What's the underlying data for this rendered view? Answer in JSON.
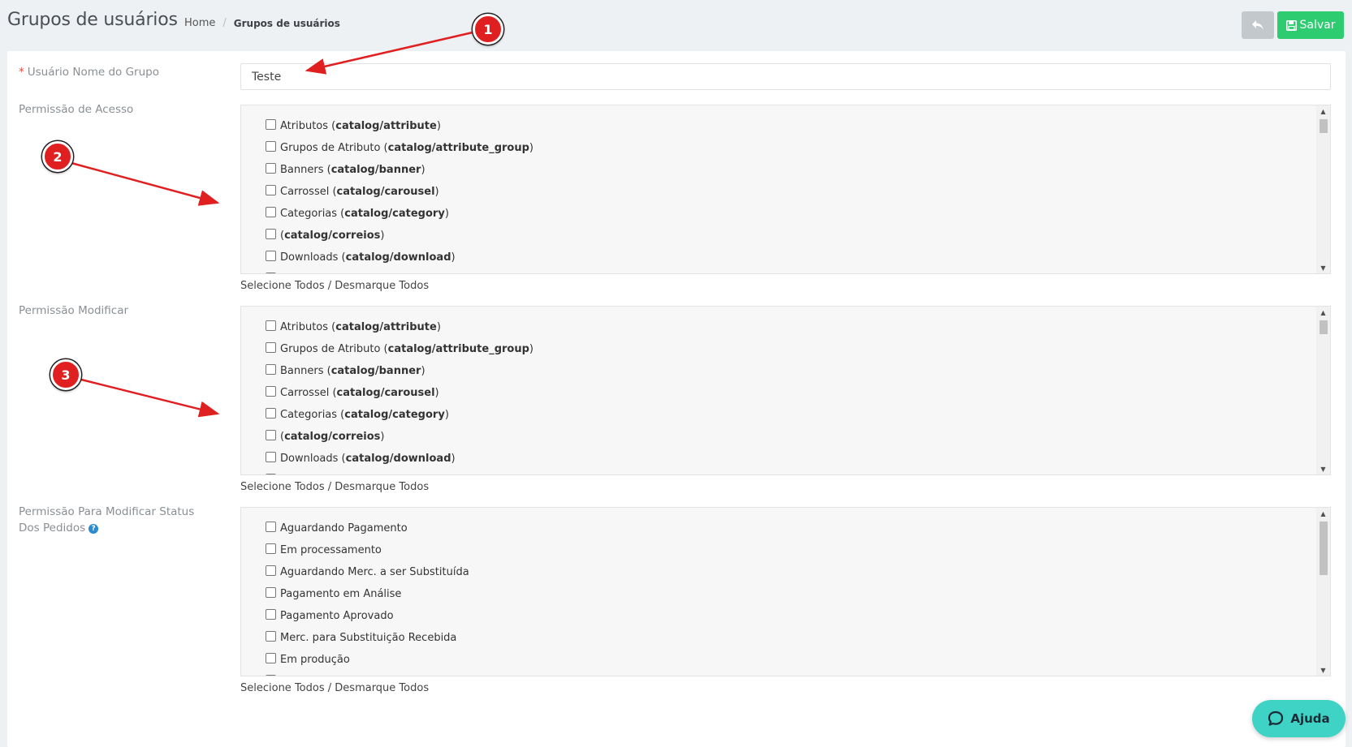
{
  "header": {
    "title": "Grupos de usuários",
    "breadcrumb": [
      {
        "label": "Home"
      },
      {
        "label": "Grupos de usuários"
      }
    ],
    "breadcrumb_separator": "/",
    "save_label": "Salvar",
    "back_icon": "reply-icon",
    "save_icon": "floppy-disk-icon"
  },
  "form": {
    "group_name": {
      "required_mark": "*",
      "label": "Usuário Nome do Grupo",
      "value": "Teste"
    },
    "access_permission": {
      "label": "Permissão de Acesso",
      "items": [
        {
          "name": "Atributos",
          "code": "catalog/attribute"
        },
        {
          "name": "Grupos de Atributo",
          "code": "catalog/attribute_group"
        },
        {
          "name": "Banners",
          "code": "catalog/banner"
        },
        {
          "name": "Carrossel",
          "code": "catalog/carousel"
        },
        {
          "name": "Categorias",
          "code": "catalog/category"
        },
        {
          "name": "",
          "code": "catalog/correios"
        },
        {
          "name": "Downloads",
          "code": "catalog/download"
        }
      ],
      "select_all": "Selecione Todos",
      "links_separator": "/",
      "deselect_all": "Desmarque Todos"
    },
    "modify_permission": {
      "label": "Permissão Modificar",
      "items": [
        {
          "name": "Atributos",
          "code": "catalog/attribute"
        },
        {
          "name": "Grupos de Atributo",
          "code": "catalog/attribute_group"
        },
        {
          "name": "Banners",
          "code": "catalog/banner"
        },
        {
          "name": "Carrossel",
          "code": "catalog/carousel"
        },
        {
          "name": "Categorias",
          "code": "catalog/category"
        },
        {
          "name": "",
          "code": "catalog/correios"
        },
        {
          "name": "Downloads",
          "code": "catalog/download"
        }
      ],
      "select_all": "Selecione Todos",
      "links_separator": "/",
      "deselect_all": "Desmarque Todos"
    },
    "order_status_permission": {
      "label": "Permissão Para Modificar Status Dos Pedidos",
      "help_icon": "question-circle-icon",
      "help_glyph": "?",
      "items": [
        {
          "name": "Aguardando Pagamento"
        },
        {
          "name": "Em processamento"
        },
        {
          "name": "Aguardando Merc. a ser Substituída"
        },
        {
          "name": "Pagamento em Análise"
        },
        {
          "name": "Pagamento Aprovado"
        },
        {
          "name": "Merc. para Substituição Recebida"
        },
        {
          "name": "Em produção"
        }
      ],
      "select_all": "Selecione Todos",
      "links_separator": "/",
      "deselect_all": "Desmarque Todos"
    }
  },
  "annotations": [
    {
      "number": "1"
    },
    {
      "number": "2"
    },
    {
      "number": "3"
    }
  ],
  "help_chat": {
    "label": "Ajuda",
    "icon": "chat-bubble-icon"
  },
  "colors": {
    "save_button": "#2ecc71",
    "back_button": "#c3c8cc",
    "required": "#e74c3c",
    "annotation": "#e02020",
    "help_chat": "#3ed3c4"
  }
}
